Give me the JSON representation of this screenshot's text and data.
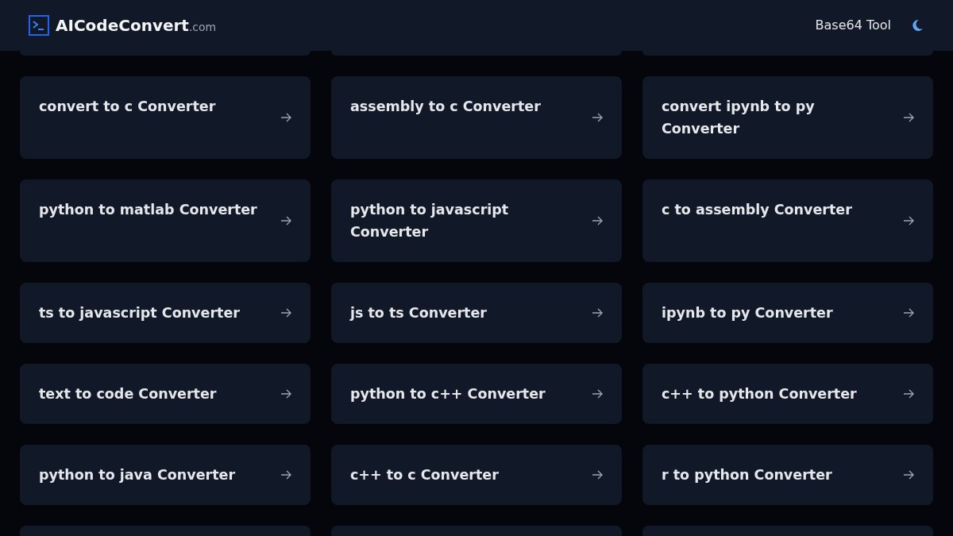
{
  "header": {
    "logo": {
      "name": "AICodeConvert",
      "suffix": ".com"
    },
    "links": [
      "Base64 Tool"
    ],
    "theme_toggle": {
      "dark": true
    }
  },
  "cards": [
    {
      "kind": "link",
      "title": "convert to c Converter"
    },
    {
      "kind": "link",
      "title": "assembly to c Converter"
    },
    {
      "kind": "link",
      "title": "convert ipynb to py Converter"
    },
    {
      "kind": "link",
      "title": "python to matlab Converter"
    },
    {
      "kind": "link",
      "title": "python to javascript Converter"
    },
    {
      "kind": "link",
      "title": "c to assembly Converter"
    },
    {
      "kind": "link",
      "title": "ts to javascript Converter"
    },
    {
      "kind": "link",
      "title": "js to ts Converter"
    },
    {
      "kind": "link",
      "title": "ipynb to py Converter"
    },
    {
      "kind": "link",
      "title": "text to code Converter"
    },
    {
      "kind": "link",
      "title": "python to c++ Converter"
    },
    {
      "kind": "link",
      "title": "c++ to python Converter"
    },
    {
      "kind": "link",
      "title": "python to java Converter"
    },
    {
      "kind": "link",
      "title": "c++ to c Converter"
    },
    {
      "kind": "link",
      "title": "r to python Converter"
    },
    {
      "kind": "clipped"
    },
    {
      "kind": "clipped"
    },
    {
      "kind": "clipped"
    }
  ]
}
